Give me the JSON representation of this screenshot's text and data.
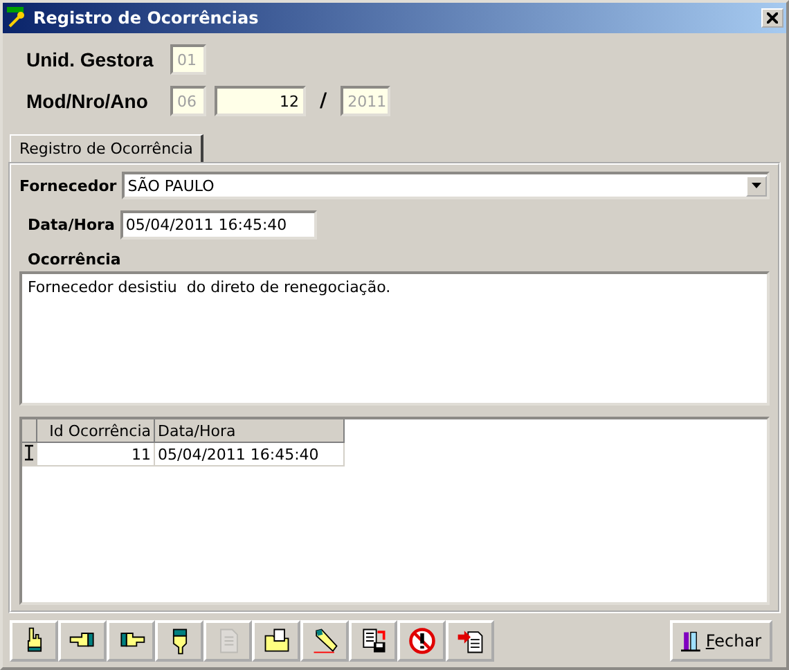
{
  "window": {
    "title": "Registro de Ocorrências"
  },
  "header": {
    "unid_label": "Unid. Gestora",
    "unid_value": "01",
    "unid_disabled": true,
    "mod_label": "Mod/Nro/Ano",
    "mod_value": "06",
    "mod_disabled": true,
    "nro_value": "12",
    "nro_disabled": false,
    "separator": "/",
    "ano_value": "2011",
    "ano_disabled": true
  },
  "tabs": [
    {
      "label": "Registro de Ocorrência",
      "selected": true
    }
  ],
  "form": {
    "fornecedor_label": "Fornecedor",
    "fornecedor_value": "SÃO PAULO",
    "datahora_label": "Data/Hora",
    "datahora_value": "05/04/2011 16:45:40",
    "ocorrencia_label": "Ocorrência",
    "ocorrencia_value": "Fornecedor desistiu  do direto de renegociação."
  },
  "table": {
    "columns": [
      "Id Ocorrência",
      "Data/Hora"
    ],
    "rows": [
      {
        "cells": [
          "11",
          "05/04/2011 16:45:40"
        ],
        "selected": true
      }
    ]
  },
  "toolbar": [
    {
      "kind": "hand-up",
      "disabled": false
    },
    {
      "kind": "hand-left",
      "disabled": false
    },
    {
      "kind": "hand-right",
      "disabled": false
    },
    {
      "kind": "hand-down",
      "disabled": false
    },
    {
      "kind": "document",
      "disabled": true
    },
    {
      "kind": "folder",
      "disabled": false
    },
    {
      "kind": "pencil",
      "disabled": false
    },
    {
      "kind": "save",
      "disabled": false
    },
    {
      "kind": "prohibit",
      "disabled": false
    },
    {
      "kind": "import",
      "disabled": false
    }
  ],
  "close_button": {
    "label": "Fechar"
  }
}
